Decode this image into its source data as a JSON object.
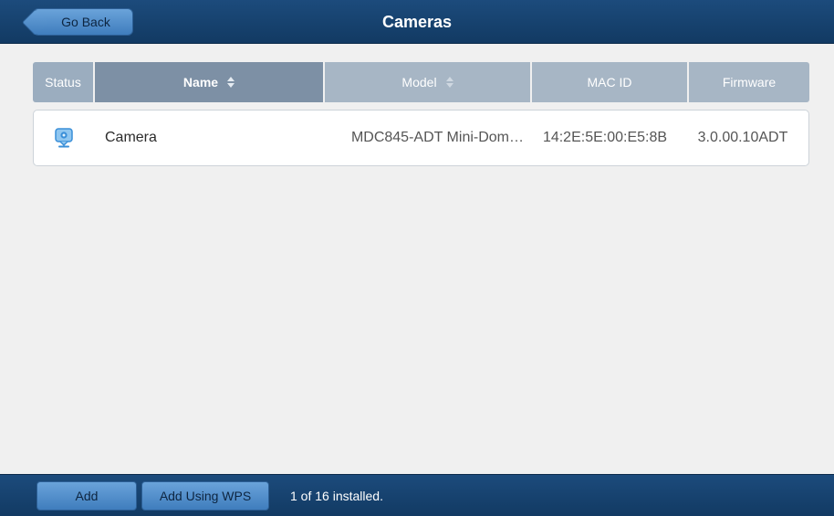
{
  "header": {
    "back_label": "Go Back",
    "title": "Cameras"
  },
  "table": {
    "columns": [
      {
        "key": "status",
        "label": "Status",
        "sortable": false
      },
      {
        "key": "name",
        "label": "Name",
        "sortable": true,
        "active": true
      },
      {
        "key": "model",
        "label": "Model",
        "sortable": true,
        "active": false
      },
      {
        "key": "mac",
        "label": "MAC ID",
        "sortable": false
      },
      {
        "key": "firmware",
        "label": "Firmware",
        "sortable": false
      }
    ],
    "rows": [
      {
        "status_icon": "camera-online-icon",
        "name": "Camera",
        "model": "MDC845-ADT Mini-Dom…",
        "mac": "14:2E:5E:00:E5:8B",
        "firmware": "3.0.00.10ADT"
      }
    ]
  },
  "footer": {
    "add_label": "Add",
    "add_wps_label": "Add Using WPS",
    "install_status": "1 of 16 installed."
  },
  "colors": {
    "header_bg": "#1c4b7c",
    "button_bg": "#4f8ccb",
    "status_icon": "#3a8fd8"
  }
}
